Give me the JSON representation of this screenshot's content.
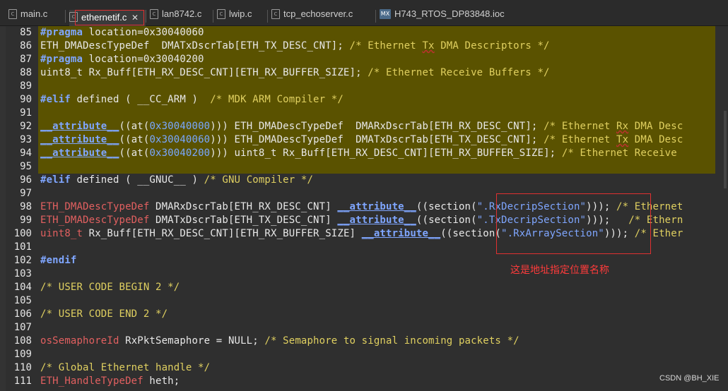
{
  "tabs": [
    {
      "label": "main.c",
      "icon": "c-file-icon"
    },
    {
      "label": "ethernetif.c",
      "icon": "c-file-icon",
      "active": true
    },
    {
      "label": "lan8742.c",
      "icon": "c-file-icon"
    },
    {
      "label": "lwip.c",
      "icon": "c-file-icon"
    },
    {
      "label": "tcp_echoserver.c",
      "icon": "c-file-icon"
    },
    {
      "label": "H743_RTOS_DP83848.ioc",
      "icon": "mx-file-icon"
    }
  ],
  "tab_close_glyph": "✕",
  "tab_icon_text": {
    "c": "c",
    "mx": "MX"
  },
  "lines": [
    {
      "num": "85",
      "tokens": [
        {
          "t": "#pragma",
          "c": "kw"
        },
        {
          "t": " location=0x30040060"
        }
      ]
    },
    {
      "num": "86",
      "tokens": [
        {
          "t": "ETH_DMADescTypeDef  DMATxDscrTab[ETH_TX_DESC_CNT]; "
        },
        {
          "t": "/* Ethernet ",
          "c": "cm"
        },
        {
          "t": "Tx",
          "c": "cmw"
        },
        {
          "t": " DMA Descriptors */",
          "c": "cm"
        }
      ]
    },
    {
      "num": "87",
      "tokens": [
        {
          "t": "#pragma",
          "c": "kw"
        },
        {
          "t": " location=0x30040200"
        }
      ]
    },
    {
      "num": "88",
      "tokens": [
        {
          "t": "uint8_t Rx_Buff[ETH_RX_DESC_CNT][ETH_RX_BUFFER_SIZE]; "
        },
        {
          "t": "/* Ethernet Receive Buffers */",
          "c": "cm"
        }
      ]
    },
    {
      "num": "89",
      "tokens": []
    },
    {
      "num": "90",
      "tokens": [
        {
          "t": "#elif",
          "c": "kw"
        },
        {
          "t": " defined ( __CC_ARM )  "
        },
        {
          "t": "/* MDK ARM Compiler */",
          "c": "cm"
        }
      ]
    },
    {
      "num": "91",
      "tokens": []
    },
    {
      "num": "92",
      "tokens": [
        {
          "t": "__attribute__",
          "c": "attr"
        },
        {
          "t": "((at("
        },
        {
          "t": "0x30040000",
          "c": "hex"
        },
        {
          "t": "))) ETH_DMADescTypeDef  DMARxDscrTab[ETH_RX_DESC_CNT]; "
        },
        {
          "t": "/* Ethernet ",
          "c": "cm"
        },
        {
          "t": "Rx",
          "c": "cmw"
        },
        {
          "t": " DMA Desc",
          "c": "cm"
        }
      ]
    },
    {
      "num": "93",
      "tokens": [
        {
          "t": "__attribute__",
          "c": "attr"
        },
        {
          "t": "((at("
        },
        {
          "t": "0x30040060",
          "c": "hex"
        },
        {
          "t": "))) ETH_DMADescTypeDef  DMATxDscrTab[ETH_TX_DESC_CNT]; "
        },
        {
          "t": "/* Ethernet ",
          "c": "cm"
        },
        {
          "t": "Tx",
          "c": "cmw"
        },
        {
          "t": " DMA Desc",
          "c": "cm"
        }
      ]
    },
    {
      "num": "94",
      "tokens": [
        {
          "t": "__attribute__",
          "c": "attr"
        },
        {
          "t": "((at("
        },
        {
          "t": "0x30040200",
          "c": "hex"
        },
        {
          "t": "))) uint8_t Rx_Buff[ETH_RX_DESC_CNT][ETH_RX_BUFFER_SIZE]; "
        },
        {
          "t": "/* Ethernet Receive",
          "c": "cm"
        }
      ]
    },
    {
      "num": "95",
      "tokens": []
    },
    {
      "num": "96",
      "tokens": [
        {
          "t": "#elif",
          "c": "kw"
        },
        {
          "t": " defined ( __GNUC__ ) "
        },
        {
          "t": "/* GNU Compiler */",
          "c": "cm"
        }
      ]
    },
    {
      "num": "97",
      "tokens": []
    },
    {
      "num": "98",
      "tokens": [
        {
          "t": "ETH_DMADescTypeDef",
          "c": "ty"
        },
        {
          "t": " DMARxDscrTab[ETH_RX_DESC_CNT] "
        },
        {
          "t": "__attribute__",
          "c": "attr"
        },
        {
          "t": "((section("
        },
        {
          "t": "\".RxDecripSection\"",
          "c": "str"
        },
        {
          "t": "))); "
        },
        {
          "t": "/* Ethernet",
          "c": "cm"
        }
      ]
    },
    {
      "num": "99",
      "tokens": [
        {
          "t": "ETH_DMADescTypeDef",
          "c": "ty"
        },
        {
          "t": " DMATxDscrTab[ETH_TX_DESC_CNT] "
        },
        {
          "t": "__attribute__",
          "c": "attr"
        },
        {
          "t": "((section("
        },
        {
          "t": "\".TxDecripSection\"",
          "c": "str"
        },
        {
          "t": ")));   "
        },
        {
          "t": "/* Ethern",
          "c": "cm"
        }
      ]
    },
    {
      "num": "100",
      "tokens": [
        {
          "t": "uint8_t",
          "c": "ty"
        },
        {
          "t": " Rx_Buff[ETH_RX_DESC_CNT][ETH_RX_BUFFER_SIZE] "
        },
        {
          "t": "__attribute__",
          "c": "attr"
        },
        {
          "t": "((section("
        },
        {
          "t": "\".RxArraySection\"",
          "c": "str"
        },
        {
          "t": "))); "
        },
        {
          "t": "/* Ether",
          "c": "cm"
        }
      ]
    },
    {
      "num": "101",
      "tokens": []
    },
    {
      "num": "102",
      "tokens": [
        {
          "t": "#endif",
          "c": "kw"
        }
      ]
    },
    {
      "num": "103",
      "tokens": []
    },
    {
      "num": "104",
      "tokens": [
        {
          "t": "/* USER CODE BEGIN 2 */",
          "c": "cm"
        }
      ]
    },
    {
      "num": "105",
      "tokens": []
    },
    {
      "num": "106",
      "tokens": [
        {
          "t": "/* USER CODE END 2 */",
          "c": "cm"
        }
      ]
    },
    {
      "num": "107",
      "tokens": []
    },
    {
      "num": "108",
      "tokens": [
        {
          "t": "osSemaphoreId",
          "c": "ty"
        },
        {
          "t": " RxPktSemaphore = NULL; "
        },
        {
          "t": "/* Semaphore to signal incoming packets */",
          "c": "cm"
        }
      ]
    },
    {
      "num": "109",
      "tokens": []
    },
    {
      "num": "110",
      "tokens": [
        {
          "t": "/* Global Ethernet handle */",
          "c": "cm"
        }
      ]
    },
    {
      "num": "111",
      "tokens": [
        {
          "t": "ETH_HandleTypeDef",
          "c": "ty"
        },
        {
          "t": " heth;"
        }
      ]
    }
  ],
  "annotation": "这是地址指定位置名称",
  "watermark": "CSDN @BH_XIE",
  "colors": {
    "editor_bg": "#2f2f2f",
    "highlight_bg": "#5a5200",
    "keyword": "#7fa6ff",
    "comment": "#e0d060",
    "type": "#e26060",
    "annotation_red": "#e03030"
  }
}
